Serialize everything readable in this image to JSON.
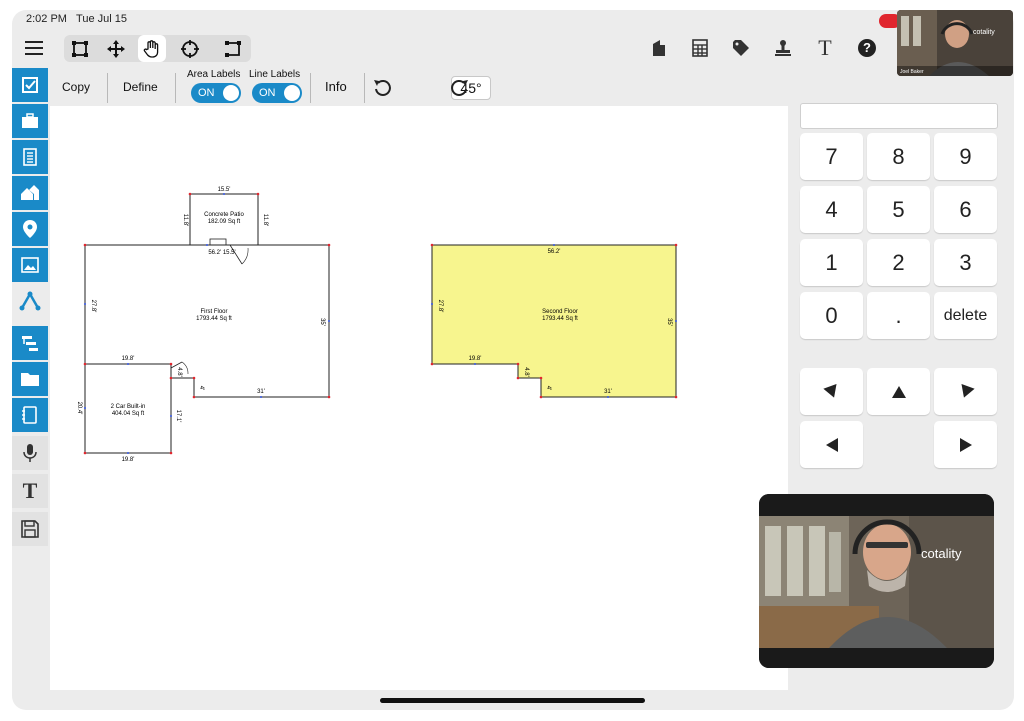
{
  "status_bar": {
    "time": "2:02 PM",
    "date": "Tue Jul 15"
  },
  "colors": {
    "accent": "#1a8ac8",
    "second_floor_fill": "#f7f58e",
    "vertex": "#e0262e",
    "record": "#e0262e"
  },
  "top_toolbar": {
    "right_icons": [
      "building-icon",
      "calculator-icon",
      "tag-icon",
      "stamp-icon",
      "text-icon",
      "help-icon"
    ],
    "text_tool_glyph": "T",
    "help_glyph": "?"
  },
  "toolbar2": {
    "copy": "Copy",
    "define": "Define",
    "area_labels": "Area Labels",
    "line_labels": "Line Labels",
    "toggle_on": "ON",
    "info": "Info",
    "angle": "45°"
  },
  "sidebar": {
    "items": [
      "checklist-icon",
      "briefcase-icon",
      "report-icon",
      "roof-icon",
      "location-icon",
      "photo-icon",
      "sketch-icon",
      "hierarchy-icon",
      "folder-icon",
      "notepad-icon",
      "microphone-icon",
      "text-icon",
      "save-icon"
    ],
    "text_glyph": "T"
  },
  "floorplan": {
    "patio": {
      "name": "Concrete Patio",
      "area": "182.09 Sq ft",
      "top": "15.5'",
      "left": "11.8'",
      "right": "11.8'"
    },
    "first_floor": {
      "name": "First Floor",
      "area": "1793.44 Sq ft",
      "top_segment": "56.2' 15.5'",
      "left": "27.8'",
      "right": "35'",
      "bottom": "31'",
      "notch_top": "19.8'",
      "notch_side_a": "4.8'",
      "notch_side_b": "4'"
    },
    "garage": {
      "name": "2 Car Built-in",
      "area": "404.04 Sq ft",
      "left": "20.4'",
      "right": "17.1'",
      "bottom": "19.8'"
    },
    "second_floor": {
      "name": "Second Floor",
      "area": "1793.44 Sq ft",
      "top": "56.2'",
      "left": "27.8'",
      "right": "35'",
      "bottom": "31'",
      "notch_top": "19.8'",
      "notch_side_a": "4.8'",
      "notch_side_b": "4'"
    }
  },
  "keypad": {
    "display_value": "",
    "keys": [
      "7",
      "8",
      "9",
      "4",
      "5",
      "6",
      "1",
      "2",
      "3",
      "0",
      ".",
      "delete"
    ]
  },
  "video": {
    "main_logo": "cotality",
    "thumb_logo": "cotality",
    "thumb_name": "Joel Baker"
  }
}
